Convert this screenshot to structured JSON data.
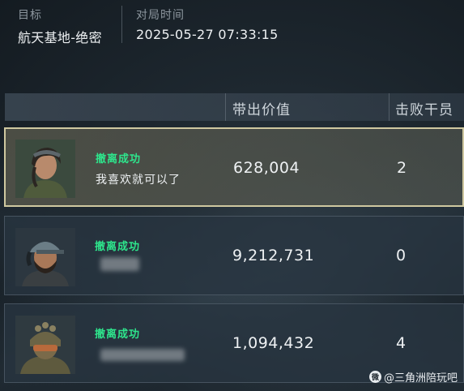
{
  "header": {
    "target_label": "目标",
    "target_value": "航天基地-绝密",
    "time_label": "对局时间",
    "time_value": "2025-05-27 07:33:15"
  },
  "columns": {
    "value_title": "带出价值",
    "kills_title": "击败干员"
  },
  "rows": [
    {
      "status": "撤离成功",
      "name": "我喜欢就可以了",
      "value": "628,004",
      "kills": "2",
      "avatar": "female-operator-avatar",
      "highlighted": true
    },
    {
      "status": "撤离成功",
      "name": "",
      "value": "9,212,731",
      "kills": "0",
      "avatar": "bearded-operator-avatar",
      "highlighted": false
    },
    {
      "status": "撤离成功",
      "name": "",
      "value": "1,094,432",
      "kills": "4",
      "avatar": "armored-operator-avatar",
      "highlighted": false
    }
  ],
  "watermark": {
    "logo": "微",
    "text": "@三角洲陪玩吧"
  },
  "colors": {
    "success": "#2ee58c",
    "highlight_border": "#cfc8a0"
  }
}
